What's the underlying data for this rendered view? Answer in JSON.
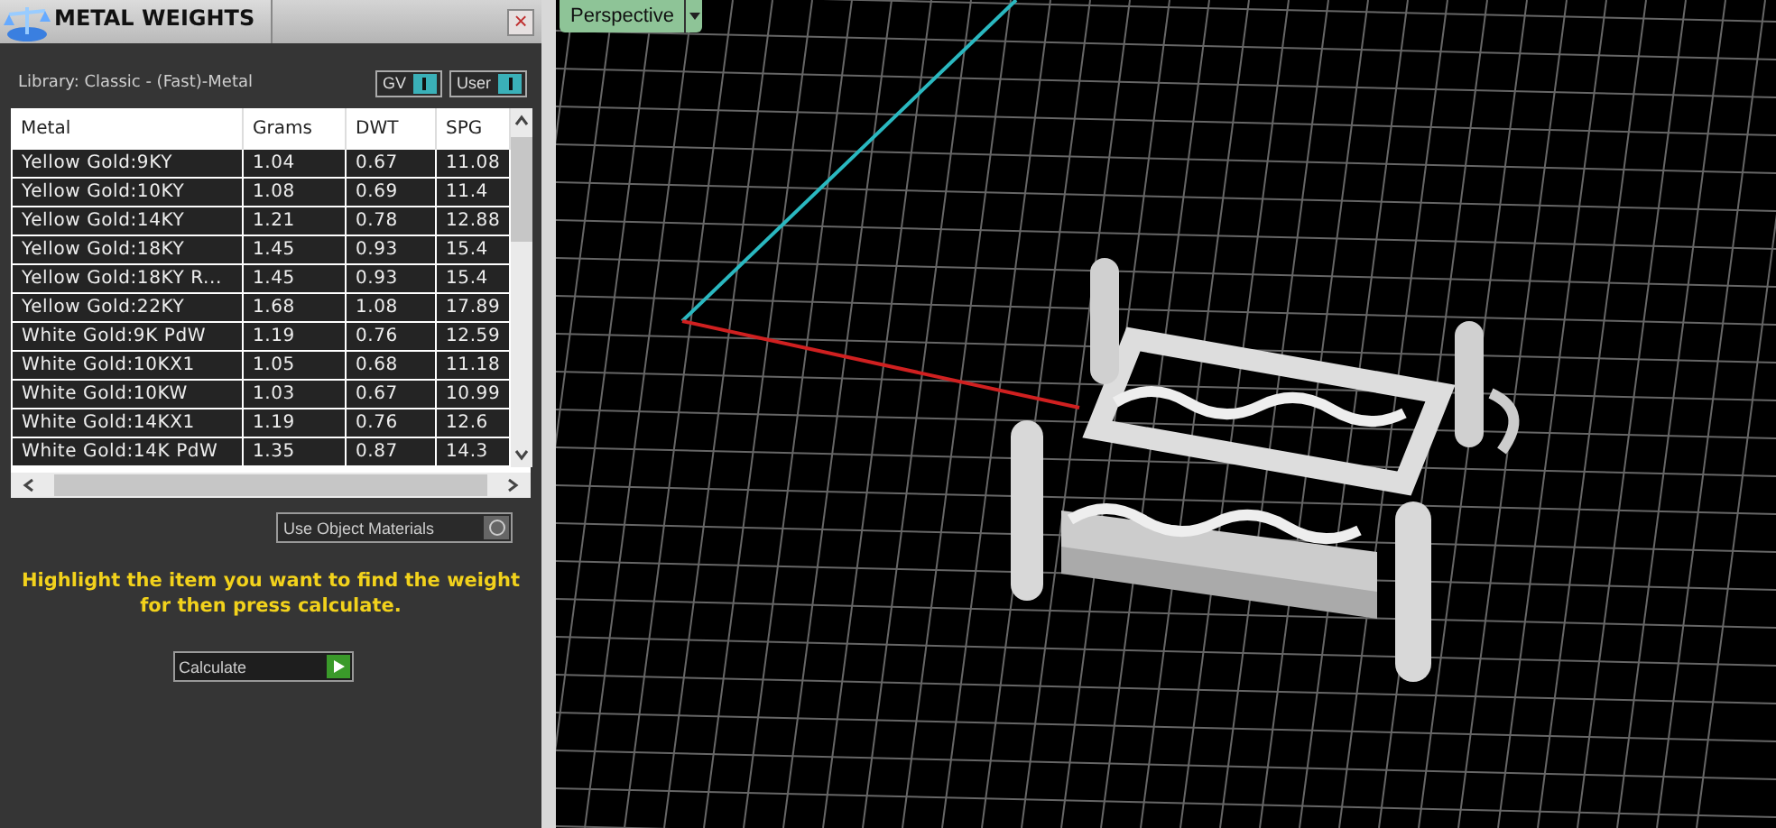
{
  "panel": {
    "title": "METAL WEIGHTS",
    "close": "×",
    "library": "Library: Classic - (Fast)-Metal",
    "toggles": [
      {
        "label": "GV",
        "on": true
      },
      {
        "label": "User",
        "on": true
      }
    ],
    "table": {
      "columns": [
        "Metal",
        "Grams",
        "DWT",
        "SPG"
      ],
      "rows": [
        [
          "Yellow Gold:9KY",
          "1.04",
          "0.67",
          "11.08"
        ],
        [
          "Yellow Gold:10KY",
          "1.08",
          "0.69",
          "11.4"
        ],
        [
          "Yellow Gold:14KY",
          "1.21",
          "0.78",
          "12.88"
        ],
        [
          "Yellow Gold:18KY",
          "1.45",
          "0.93",
          "15.4"
        ],
        [
          "Yellow Gold:18KY R...",
          "1.45",
          "0.93",
          "15.4"
        ],
        [
          "Yellow Gold:22KY",
          "1.68",
          "1.08",
          "17.89"
        ],
        [
          "White Gold:9K PdW",
          "1.19",
          "0.76",
          "12.59"
        ],
        [
          "White Gold:10KX1",
          "1.05",
          "0.68",
          "11.18"
        ],
        [
          "White Gold:10KW",
          "1.03",
          "0.67",
          "10.99"
        ],
        [
          "White Gold:14KX1",
          "1.19",
          "0.76",
          "12.6"
        ],
        [
          "White Gold:14K PdW",
          "1.35",
          "0.87",
          "14.3"
        ]
      ]
    },
    "object_materials": {
      "label": "Use Object Materials",
      "on": false
    },
    "message": "Highlight the item you want to find the weight for then press calculate.",
    "calculate": "Calculate"
  },
  "viewport": {
    "label": "Perspective"
  }
}
